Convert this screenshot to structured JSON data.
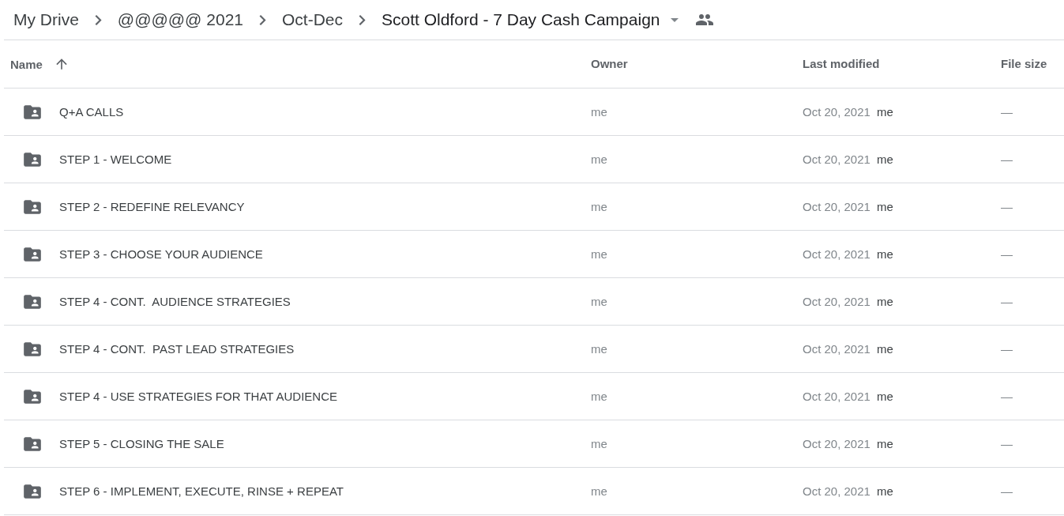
{
  "breadcrumb": [
    {
      "label": "My Drive"
    },
    {
      "label": "@@@@@ 2021"
    },
    {
      "label": "Oct-Dec"
    },
    {
      "label": "Scott Oldford - 7 Day Cash Campaign",
      "current": true
    }
  ],
  "table": {
    "columns": [
      {
        "label": "Name",
        "sorted": true
      },
      {
        "label": "Owner",
        "sorted": false
      },
      {
        "label": "Last modified",
        "sorted": false
      },
      {
        "label": "File size",
        "sorted": false
      }
    ],
    "rows": [
      {
        "name": "Q+A CALLS",
        "owner": "me",
        "modified": "Oct 20, 2021",
        "modified_by": "me",
        "size": "—"
      },
      {
        "name": "STEP 1 - WELCOME",
        "owner": "me",
        "modified": "Oct 20, 2021",
        "modified_by": "me",
        "size": "—"
      },
      {
        "name": "STEP 2 - REDEFINE RELEVANCY",
        "owner": "me",
        "modified": "Oct 20, 2021",
        "modified_by": "me",
        "size": "—"
      },
      {
        "name": "STEP 3 - CHOOSE YOUR AUDIENCE",
        "owner": "me",
        "modified": "Oct 20, 2021",
        "modified_by": "me",
        "size": "—"
      },
      {
        "name": "STEP 4 - CONT.  AUDIENCE STRATEGIES",
        "owner": "me",
        "modified": "Oct 20, 2021",
        "modified_by": "me",
        "size": "—"
      },
      {
        "name": "STEP 4 - CONT.  PAST LEAD STRATEGIES",
        "owner": "me",
        "modified": "Oct 20, 2021",
        "modified_by": "me",
        "size": "—"
      },
      {
        "name": "STEP 4 - USE STRATEGIES FOR THAT AUDIENCE",
        "owner": "me",
        "modified": "Oct 20, 2021",
        "modified_by": "me",
        "size": "—"
      },
      {
        "name": "STEP 5 - CLOSING THE SALE",
        "owner": "me",
        "modified": "Oct 20, 2021",
        "modified_by": "me",
        "size": "—"
      },
      {
        "name": "STEP 6 - IMPLEMENT, EXECUTE, RINSE + REPEAT",
        "owner": "me",
        "modified": "Oct 20, 2021",
        "modified_by": "me",
        "size": "—"
      }
    ]
  }
}
